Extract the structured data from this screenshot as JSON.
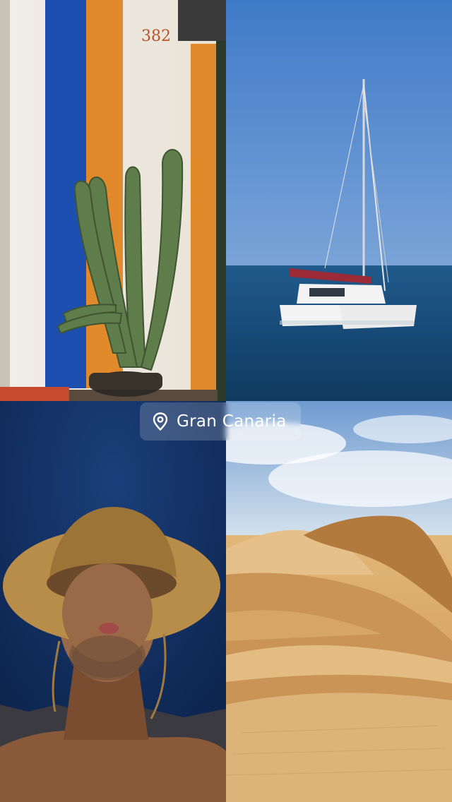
{
  "story": {
    "location_sticker": {
      "label": "Gran Canaria",
      "icon": "location-pin-icon"
    },
    "photos": [
      {
        "subject": "cactus",
        "house_number": "382"
      },
      {
        "subject": "catamaran"
      },
      {
        "subject": "selfie-straw-hat"
      },
      {
        "subject": "sand-dunes"
      }
    ]
  },
  "colors": {
    "wall": "#f2ede4",
    "blue_stripe": "#1d4fb0",
    "orange_stripe": "#e08a2b",
    "sky": "#3f7ac8",
    "sea": "#164a78",
    "sand": "#d9a462",
    "sticker_text": "#ffffff"
  }
}
